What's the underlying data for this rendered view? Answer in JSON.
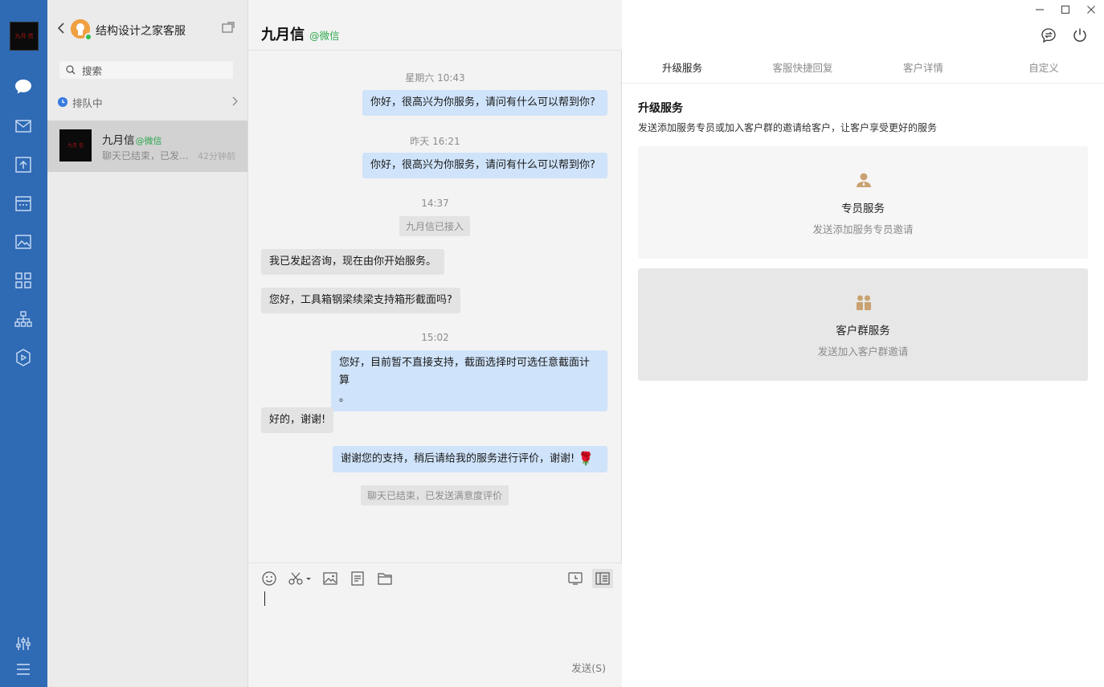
{
  "rail": {
    "icons": [
      "chat-icon",
      "mail-icon",
      "upload-icon",
      "calendar-icon",
      "photos-icon",
      "apps-icon",
      "org-icon",
      "box-icon",
      "settings-icon",
      "menu-icon"
    ],
    "accent": "#2f6ab5",
    "avatar_text": "九月\n信"
  },
  "sessions": {
    "account_name": "结构设计之家客服",
    "search_placeholder": "搜索",
    "queue_label": "排队中",
    "conversation": {
      "name": "九月信",
      "source": "@微信",
      "preview": "聊天已结束，已发...",
      "time": "42分钟前"
    }
  },
  "chat": {
    "title": "九月信",
    "source": "@微信",
    "messages": {
      "ts1": "星期六 10:43",
      "m1": "你好，很高兴为你服务，请问有什么可以帮到你?",
      "ts2": "昨天 16:21",
      "m2": "你好，很高兴为你服务，请问有什么可以帮到你?",
      "ts3": "14:37",
      "sys1": "九月信已接入",
      "m3": "我已发起咨询，现在由你开始服务。",
      "m4": "您好，工具箱钢梁续梁支持箱形截面吗?",
      "ts4": "15:02",
      "m5_line1": "您好，目前暂不直接支持，截面选择时可选任意截面计算",
      "m5_line2": "。",
      "m6": "好的，谢谢!",
      "m7": "谢谢您的支持，稍后请给我的服务进行评价，谢谢!",
      "sys2": "聊天已结束，已发送满意度评价"
    },
    "send_label": "发送(S)",
    "outgoing_color": "#cfe3fa",
    "incoming_color": "#e3e3e3"
  },
  "panel": {
    "tabs": [
      "升级服务",
      "客服快捷回复",
      "客户详情",
      "自定义"
    ],
    "active_tab": 0,
    "title": "升级服务",
    "description": "发送添加服务专员或加入客户群的邀请给客户，让客户享受更好的服务",
    "cards": [
      {
        "title": "专员服务",
        "subtitle": "发送添加服务专员邀请"
      },
      {
        "title": "客户群服务",
        "subtitle": "发送加入客户群邀请"
      }
    ],
    "icon_color": "#c9a272"
  }
}
